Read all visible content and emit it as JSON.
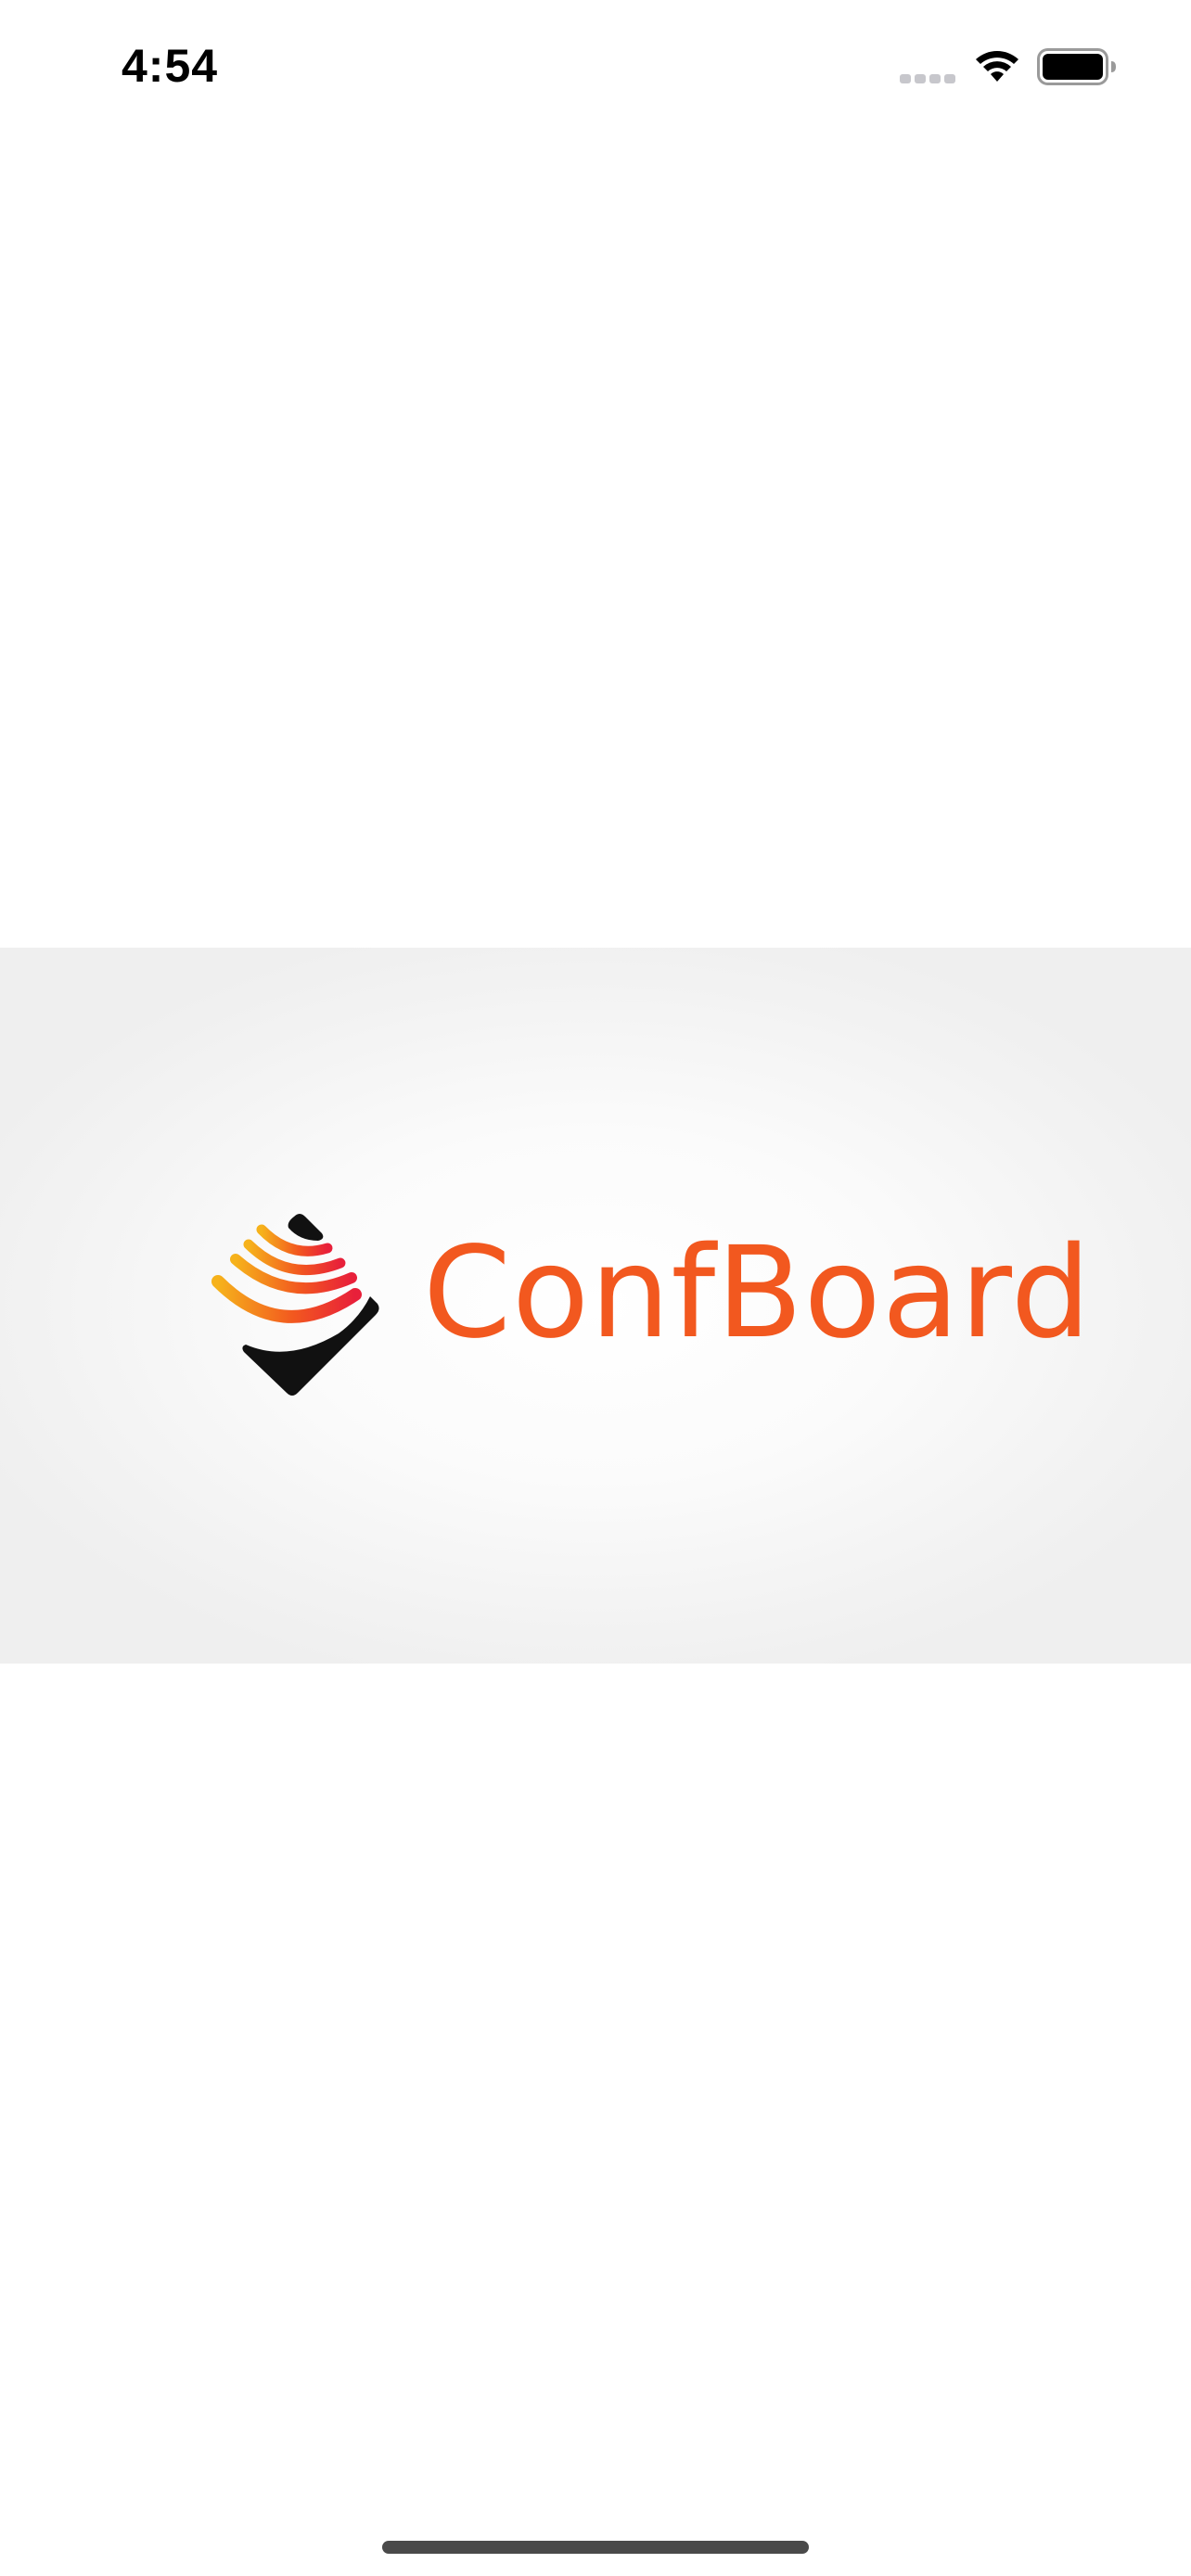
{
  "status_bar": {
    "time": "4:54",
    "icons": [
      "signal-icon",
      "wifi-icon",
      "battery-icon"
    ]
  },
  "splash": {
    "logo_text": "ConfBoard",
    "logo_icon": "confboard-logo-icon",
    "colors": {
      "brand_orange": "#f2581f",
      "gradient_yellow": "#f6b21b",
      "gradient_red": "#e8203a",
      "mark_black": "#111111",
      "banner_edge": "#efefef"
    }
  }
}
